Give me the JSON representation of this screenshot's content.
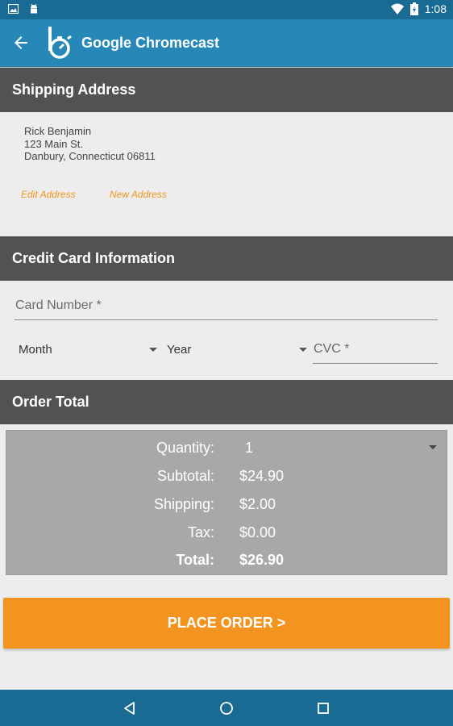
{
  "status_bar": {
    "time": "1:08"
  },
  "app_bar": {
    "title": "Google Chromecast"
  },
  "shipping": {
    "header": "Shipping Address",
    "address_lines": [
      "Rick Benjamin",
      "123 Main St.",
      "Danbury, Connecticut 06811"
    ],
    "edit_label": "Edit Address",
    "new_label": "New Address"
  },
  "credit_card": {
    "header": "Credit Card Information",
    "card_number_placeholder": "Card Number *",
    "month_label": "Month",
    "year_label": "Year",
    "cvc_placeholder": "CVC *"
  },
  "order": {
    "header": "Order Total",
    "quantity_label": "Quantity:",
    "quantity_value": "1",
    "subtotal_label": "Subtotal:",
    "subtotal_value": "$24.90",
    "shipping_label": "Shipping:",
    "shipping_value": "$2.00",
    "tax_label": "Tax:",
    "tax_value": "$0.00",
    "total_label": "Total:",
    "total_value": "$26.90"
  },
  "place_order_label": "PLACE ORDER >",
  "colors": {
    "app_bar": "#2788b7",
    "status_bar": "#1a6b93",
    "section_header": "#525252",
    "accent": "#f39421",
    "link": "#f0961c",
    "order_box": "#a8a8a8"
  },
  "icons": {
    "status_left": [
      "image-icon",
      "android-icon"
    ],
    "status_right": [
      "wifi-icon",
      "battery-icon"
    ],
    "app_bar": [
      "back-arrow-icon",
      "app-logo-icon"
    ],
    "nav": [
      "back-triangle-icon",
      "home-circle-icon",
      "recents-square-icon"
    ]
  }
}
